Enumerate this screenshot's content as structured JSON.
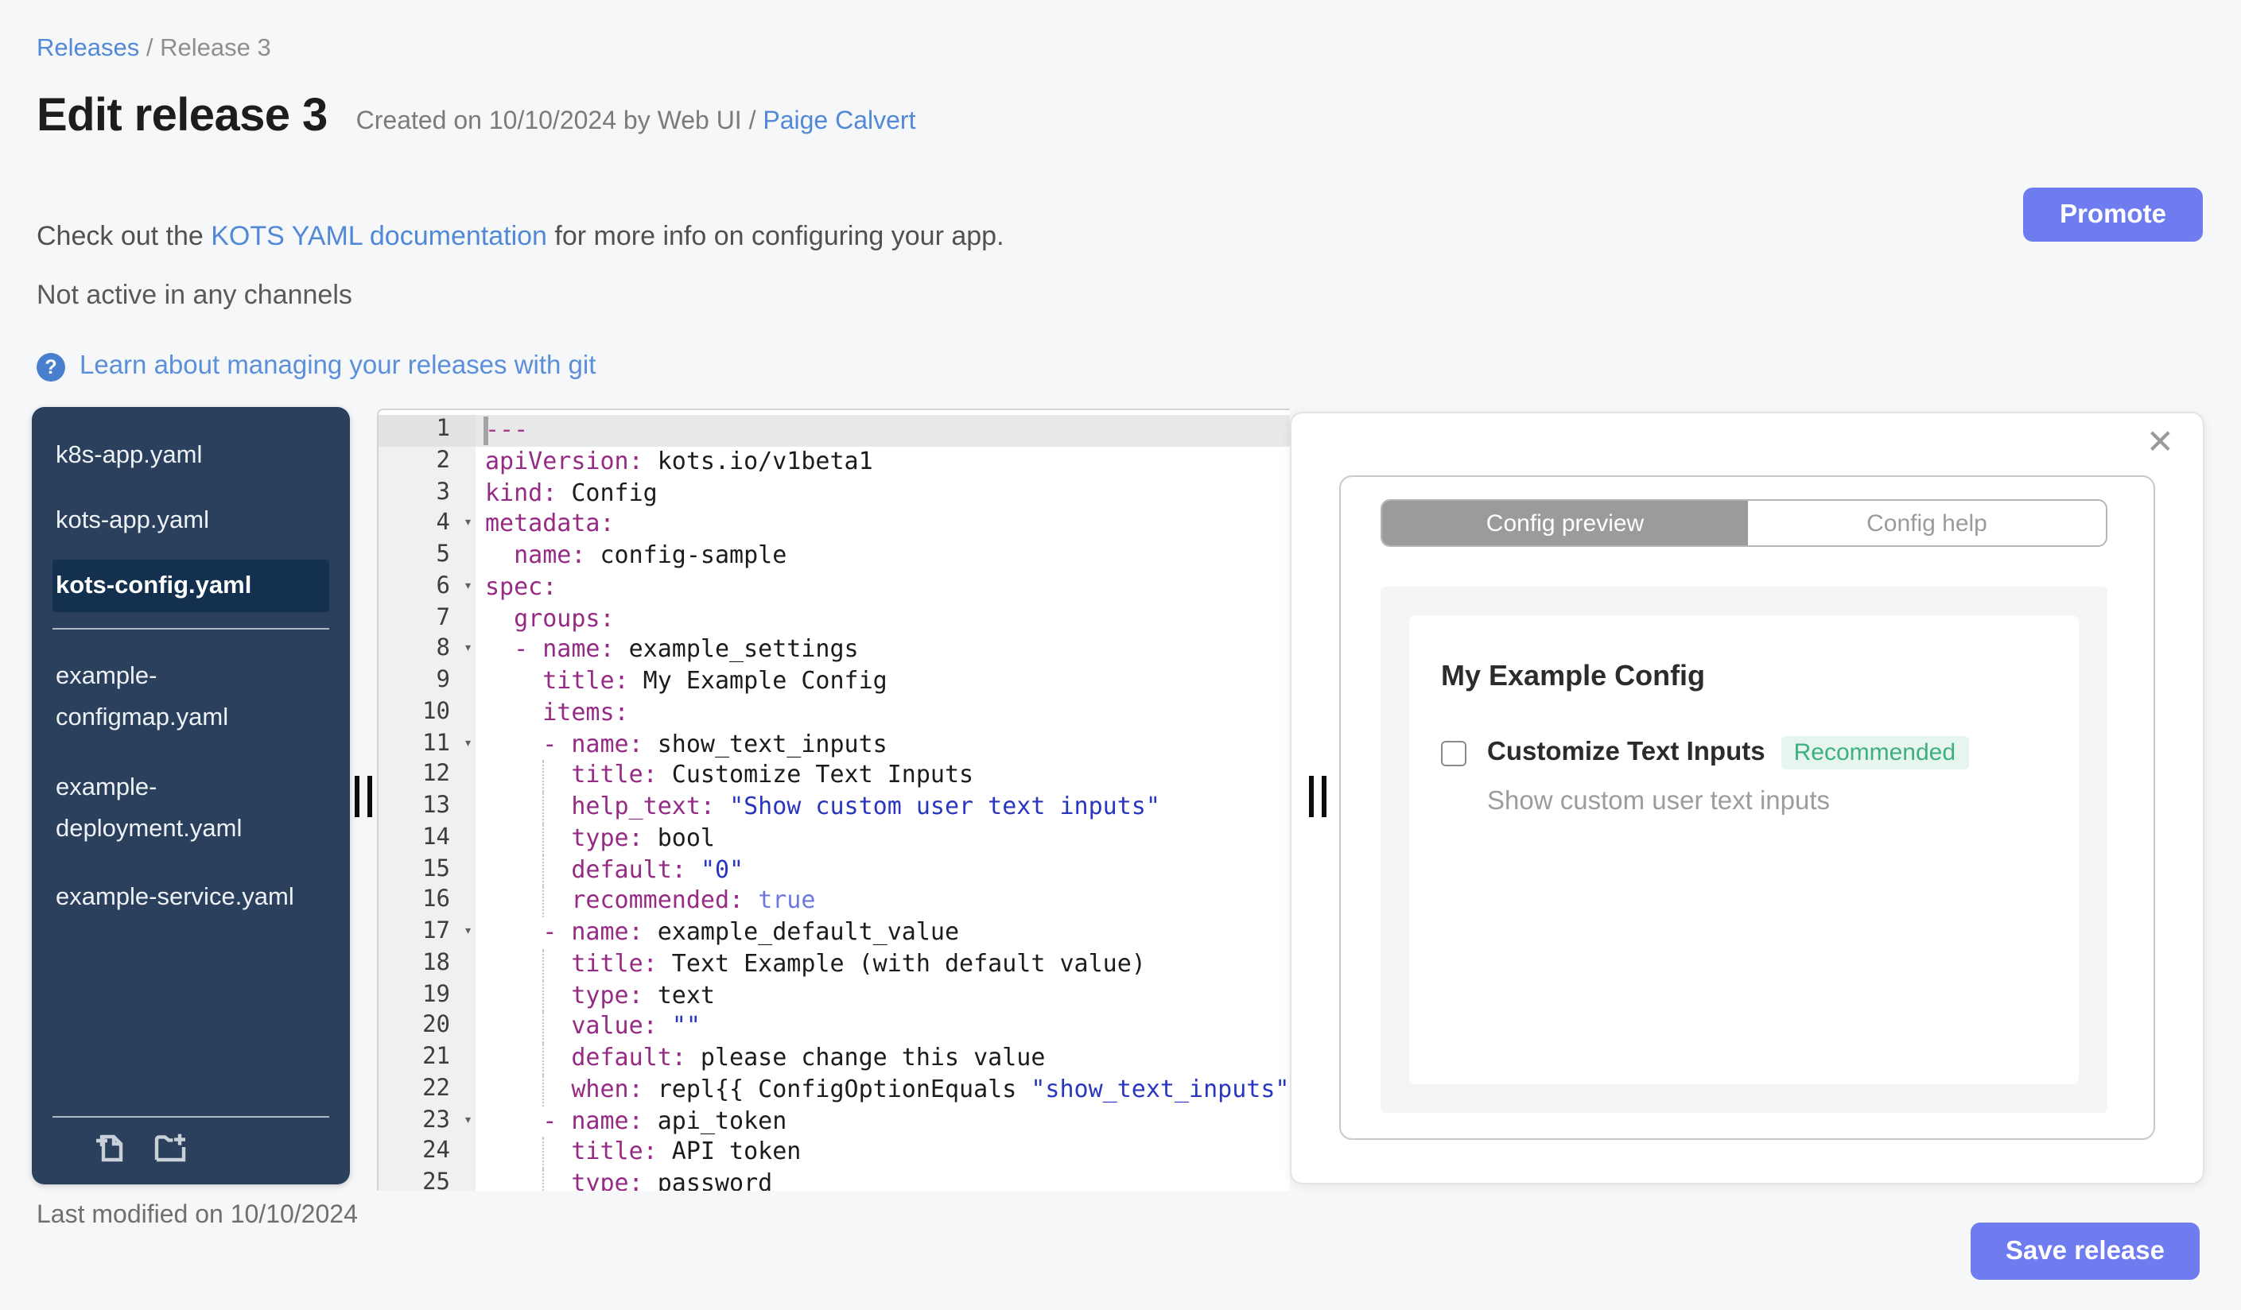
{
  "breadcrumb": {
    "releases": "Releases",
    "separator": " / ",
    "current": "Release 3"
  },
  "header": {
    "title": "Edit release 3",
    "created_text": "Created on 10/10/2024 by Web UI / ",
    "author_link": "Paige Calvert",
    "promote_label": "Promote"
  },
  "info": {
    "doc_prefix": "Check out the ",
    "doc_link": "KOTS YAML documentation",
    "doc_suffix": " for more info on configuring your app.",
    "channel_status": "Not active in any channels",
    "help_icon": "?",
    "git_link_label": "Learn about managing your releases with git"
  },
  "sidebar": {
    "groups": [
      {
        "files": [
          {
            "name": "k8s-app.yaml",
            "lines": [
              "k8s-app.yaml"
            ],
            "selected": false
          },
          {
            "name": "kots-app.yaml",
            "lines": [
              "kots-app.yaml"
            ],
            "selected": false
          },
          {
            "name": "kots-config.yaml",
            "lines": [
              "kots-config.yaml"
            ],
            "selected": true
          }
        ]
      },
      {
        "files": [
          {
            "name": "example-configmap.yaml",
            "lines": [
              "example-",
              "configmap.yaml"
            ],
            "selected": false
          },
          {
            "name": "example-deployment.yaml",
            "lines": [
              "example-",
              "deployment.yaml"
            ],
            "selected": false
          },
          {
            "name": "example-service.yaml",
            "lines": [
              "example-service.yaml"
            ],
            "selected": false
          }
        ]
      }
    ],
    "actions": [
      {
        "icon": "new-file-icon"
      },
      {
        "icon": "new-folder-icon"
      }
    ]
  },
  "editor": {
    "active_line": 1,
    "lines": [
      {
        "n": 1,
        "fold": false,
        "g": false,
        "t": [
          [
            "d",
            "---"
          ]
        ]
      },
      {
        "n": 2,
        "fold": false,
        "g": false,
        "t": [
          [
            "k",
            "apiVersion:"
          ],
          [
            "p",
            " kots.io/v1beta1"
          ]
        ]
      },
      {
        "n": 3,
        "fold": false,
        "g": false,
        "t": [
          [
            "k",
            "kind:"
          ],
          [
            "p",
            " Config"
          ]
        ]
      },
      {
        "n": 4,
        "fold": true,
        "g": false,
        "t": [
          [
            "k",
            "metadata:"
          ]
        ]
      },
      {
        "n": 5,
        "fold": false,
        "g": false,
        "t": [
          [
            "p",
            "  "
          ],
          [
            "k",
            "name:"
          ],
          [
            "p",
            " config-sample"
          ]
        ]
      },
      {
        "n": 6,
        "fold": true,
        "g": false,
        "t": [
          [
            "k",
            "spec:"
          ]
        ]
      },
      {
        "n": 7,
        "fold": false,
        "g": false,
        "t": [
          [
            "p",
            "  "
          ],
          [
            "k",
            "groups:"
          ]
        ]
      },
      {
        "n": 8,
        "fold": true,
        "g": false,
        "t": [
          [
            "p",
            "  "
          ],
          [
            "k",
            "- name:"
          ],
          [
            "p",
            " example_settings"
          ]
        ]
      },
      {
        "n": 9,
        "fold": false,
        "g": false,
        "t": [
          [
            "p",
            "    "
          ],
          [
            "k",
            "title:"
          ],
          [
            "p",
            " My Example Config"
          ]
        ]
      },
      {
        "n": 10,
        "fold": false,
        "g": false,
        "t": [
          [
            "p",
            "    "
          ],
          [
            "k",
            "items:"
          ]
        ]
      },
      {
        "n": 11,
        "fold": true,
        "g": false,
        "t": [
          [
            "p",
            "    "
          ],
          [
            "k",
            "- name:"
          ],
          [
            "p",
            " show_text_inputs"
          ]
        ]
      },
      {
        "n": 12,
        "fold": false,
        "g": true,
        "t": [
          [
            "p",
            "      "
          ],
          [
            "k",
            "title:"
          ],
          [
            "p",
            " Customize Text Inputs"
          ]
        ]
      },
      {
        "n": 13,
        "fold": false,
        "g": true,
        "t": [
          [
            "p",
            "      "
          ],
          [
            "k",
            "help_text:"
          ],
          [
            "p",
            " "
          ],
          [
            "s",
            "\"Show custom user text inputs\""
          ]
        ]
      },
      {
        "n": 14,
        "fold": false,
        "g": true,
        "t": [
          [
            "p",
            "      "
          ],
          [
            "k",
            "type:"
          ],
          [
            "p",
            " bool"
          ]
        ]
      },
      {
        "n": 15,
        "fold": false,
        "g": true,
        "t": [
          [
            "p",
            "      "
          ],
          [
            "k",
            "default:"
          ],
          [
            "p",
            " "
          ],
          [
            "s",
            "\"0\""
          ]
        ]
      },
      {
        "n": 16,
        "fold": false,
        "g": true,
        "t": [
          [
            "p",
            "      "
          ],
          [
            "k",
            "recommended:"
          ],
          [
            "p",
            " "
          ],
          [
            "b",
            "true"
          ]
        ]
      },
      {
        "n": 17,
        "fold": true,
        "g": false,
        "t": [
          [
            "p",
            "    "
          ],
          [
            "k",
            "- name:"
          ],
          [
            "p",
            " example_default_value"
          ]
        ]
      },
      {
        "n": 18,
        "fold": false,
        "g": true,
        "t": [
          [
            "p",
            "      "
          ],
          [
            "k",
            "title:"
          ],
          [
            "p",
            " Text Example (with default value)"
          ]
        ]
      },
      {
        "n": 19,
        "fold": false,
        "g": true,
        "t": [
          [
            "p",
            "      "
          ],
          [
            "k",
            "type:"
          ],
          [
            "p",
            " text"
          ]
        ]
      },
      {
        "n": 20,
        "fold": false,
        "g": true,
        "t": [
          [
            "p",
            "      "
          ],
          [
            "k",
            "value:"
          ],
          [
            "p",
            " "
          ],
          [
            "s",
            "\"\""
          ]
        ]
      },
      {
        "n": 21,
        "fold": false,
        "g": true,
        "t": [
          [
            "p",
            "      "
          ],
          [
            "k",
            "default:"
          ],
          [
            "p",
            " please change this value"
          ]
        ]
      },
      {
        "n": 22,
        "fold": false,
        "g": true,
        "t": [
          [
            "p",
            "      "
          ],
          [
            "k",
            "when:"
          ],
          [
            "p",
            " repl{{ ConfigOptionEquals "
          ],
          [
            "s",
            "\"show_text_inputs\""
          ]
        ]
      },
      {
        "n": 23,
        "fold": true,
        "g": false,
        "t": [
          [
            "p",
            "    "
          ],
          [
            "k",
            "- name:"
          ],
          [
            "p",
            " api_token"
          ]
        ]
      },
      {
        "n": 24,
        "fold": false,
        "g": true,
        "t": [
          [
            "p",
            "      "
          ],
          [
            "k",
            "title:"
          ],
          [
            "p",
            " API token"
          ]
        ]
      },
      {
        "n": 25,
        "fold": false,
        "g": true,
        "t": [
          [
            "p",
            "      "
          ],
          [
            "k",
            "type:"
          ],
          [
            "p",
            " password"
          ]
        ]
      }
    ]
  },
  "preview": {
    "close_icon": "✕",
    "tabs": [
      {
        "label": "Config preview",
        "active": true
      },
      {
        "label": "Config help",
        "active": false
      }
    ],
    "heading": "My Example Config",
    "item": {
      "label": "Customize Text Inputs",
      "badge": "Recommended",
      "help_text": "Show custom user text inputs",
      "checked": false
    }
  },
  "footer": {
    "last_modified": "Last modified on 10/10/2024",
    "save_label": "Save release"
  },
  "colors": {
    "accent_button": "#6e7cf0",
    "link": "#5289d6",
    "sidebar_bg": "#2a405c",
    "sidebar_selected_bg": "#13304e",
    "badge_green": "#3fae85",
    "badge_green_bg": "#e6f5ee",
    "yaml_key": "#962b85",
    "yaml_string": "#2936bf",
    "yaml_bool": "#6f79dd",
    "active_tab_bg": "#9b9b9b"
  }
}
